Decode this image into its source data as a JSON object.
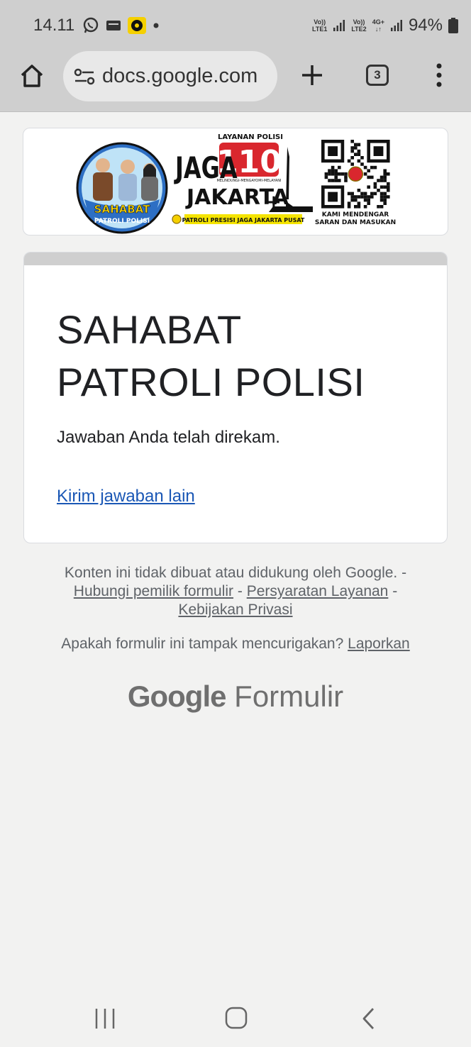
{
  "status_bar": {
    "time": "14.11",
    "sim1": [
      "Vo))",
      "LTE1"
    ],
    "sim2": [
      "Vo))",
      "LTE2"
    ],
    "network": "4G+",
    "battery": "94%",
    "icons": [
      "whatsapp-icon",
      "message-icon",
      "app-icon",
      "dot-icon",
      "signal-icon",
      "battery-icon"
    ]
  },
  "browser": {
    "url": "docs.google.com",
    "tab_count": "3",
    "icons": [
      "home-icon",
      "site-settings-icon",
      "new-tab-icon",
      "tab-switcher-icon",
      "more-menu-icon"
    ]
  },
  "banner": {
    "badge_title": "SAHABAT",
    "badge_subtitle": "PATROLI POLISI",
    "service_label": "LAYANAN POLISI",
    "number": "110",
    "tagline": "MELINDUNGI-MENGAYOMI-MELAYANI",
    "campaign_line1": "JAGA",
    "campaign_line2": "JAKARTA",
    "campaign_plus": "+",
    "strip": "PATROLI PRESISI JAGA JAKARTA PUSAT",
    "qr_caption_line1": "KAMI MENDENGAR",
    "qr_caption_line2": "SARAN DAN MASUKAN"
  },
  "form": {
    "title_line1": "SAHABAT",
    "title_line2": "PATROLI POLISI",
    "message": "Jawaban Anda telah direkam.",
    "link": "Kirim jawaban lain"
  },
  "footer": {
    "disclaimer": "Konten ini tidak dibuat atau didukung oleh Google. -",
    "contact": "Hubungi pemilik formulir",
    "sep": "-",
    "terms": "Persyaratan Layanan",
    "privacy": "Kebijakan Privasi",
    "suspicious": "Apakah formulir ini tampak mencurigakan?",
    "report": "Laporkan",
    "brand_google": "Google",
    "brand_forms": "Formulir"
  },
  "nav": {
    "icons": [
      "recent-apps-icon",
      "home-nav-icon",
      "back-icon"
    ]
  },
  "colors": {
    "link": "#1a57b5",
    "chrome": "#cfcfcf",
    "background": "#f2f2f1",
    "accent_red": "#d9272e",
    "badge_blue": "#2d6fc4"
  }
}
